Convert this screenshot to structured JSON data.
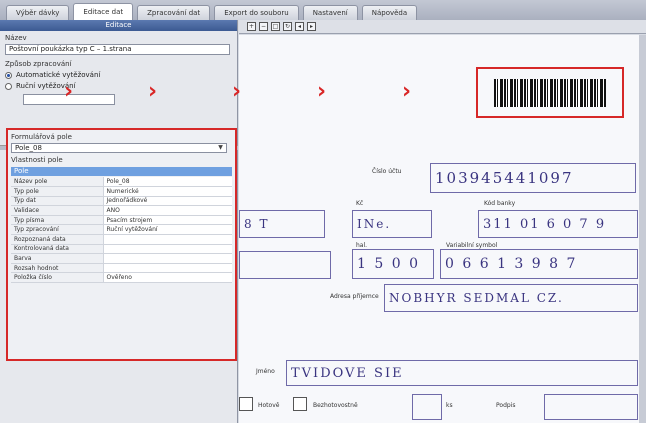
{
  "tabs": [
    {
      "label": "Výběr dávky",
      "active": false
    },
    {
      "label": "Editace dat",
      "active": true
    },
    {
      "label": "Zpracování dat",
      "active": false
    },
    {
      "label": "Export do souboru",
      "active": false
    },
    {
      "label": "Nastavení",
      "active": false
    },
    {
      "label": "Nápověda",
      "active": false
    }
  ],
  "left_panel": {
    "title": "Editace",
    "name_label": "Název",
    "name_value": "Poštovní poukázka typ C – 1.strana",
    "mode_label": "Způsob zpracování",
    "radio_auto": "Automatické vytěžování",
    "radio_manual": "Ruční vytěžování"
  },
  "properties": {
    "section_label": "Formulářová pole",
    "combo_value": "Pole_08",
    "group_label": "Vlastnosti pole",
    "selected_row": "Pole",
    "rows": [
      {
        "key": "Název pole",
        "value": "Pole_08"
      },
      {
        "key": "Typ pole",
        "value": "Numerické"
      },
      {
        "key": "Typ dat",
        "value": "Jednořádkové"
      },
      {
        "key": "Validace",
        "value": "ANO"
      },
      {
        "key": "Typ písma",
        "value": "Psacím strojem"
      },
      {
        "key": "Typ zpracování",
        "value": "Ruční vytěžování"
      },
      {
        "key": "Rozpoznaná data",
        "value": ""
      },
      {
        "key": "Kontrolovaná data",
        "value": ""
      },
      {
        "key": "Barva",
        "value": ""
      },
      {
        "key": "Rozsah hodnot",
        "value": ""
      },
      {
        "key": "Položka číslo",
        "value": "Ověřeno"
      }
    ]
  },
  "toolbar": {
    "icons": [
      "zoom-in-icon",
      "zoom-out-icon",
      "fit-page-icon",
      "rotate-icon",
      "previous-page-icon",
      "next-page-icon"
    ]
  },
  "document": {
    "label_account": "Číslo účtu",
    "account_value": "103945441097",
    "field_partial": "8 T",
    "label_kc": "Kč",
    "kc_value": "INe.",
    "label_bank_code": "Kód banky",
    "bank_code_value": "311 01 6 0 7 9",
    "label_hal": "hal.",
    "hal_value": "1 5 0 0",
    "label_variable": "Variabilní symbol",
    "variable_value": "0 6 6 1 3 9 8 7",
    "label_recipient": "Adresa příjemce",
    "recipient_value": "NOBHYR SEDMAL CZ.",
    "label_name": "Jméno",
    "name_value": "TVIDOVE SIE",
    "label_checkbox1": "Hotově",
    "label_checkbox2": "Bezhotovostně",
    "label_amount": "ks",
    "label_signature": "Podpis"
  },
  "accent_color": "#d62828",
  "handwriting_color": "#3a3480"
}
